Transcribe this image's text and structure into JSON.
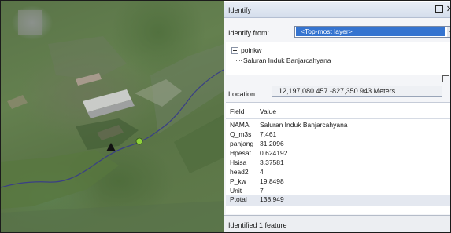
{
  "window": {
    "title": "Identify"
  },
  "identify_from": {
    "label": "Identify from:",
    "selected": "<Top-most layer>"
  },
  "results_tree": {
    "layer": "poinkw",
    "feature": "Saluran Induk Banjarcahyana"
  },
  "location": {
    "label": "Location:",
    "value": "12,197,080.457 -827,350.943 Meters"
  },
  "attributes": {
    "field_header": "Field",
    "value_header": "Value",
    "rows": [
      {
        "field": "NAMA",
        "value": "Saluran Induk Banjarcahyana"
      },
      {
        "field": "Q_m3s",
        "value": "7.461"
      },
      {
        "field": "panjang",
        "value": "31.2096"
      },
      {
        "field": "Hpesat",
        "value": "0.624192"
      },
      {
        "field": "Hsisa",
        "value": "3.37581"
      },
      {
        "field": "head2",
        "value": "4"
      },
      {
        "field": "P_kw",
        "value": "19.8498"
      },
      {
        "field": "Unit",
        "value": "7"
      },
      {
        "field": "Ptotal",
        "value": "138.949"
      }
    ]
  },
  "status": {
    "text": "Identified 1 feature"
  },
  "map": {
    "canal_color": "#3a3f86",
    "point_color": "#8fd13a",
    "marker_color": "#111111",
    "icons": [
      "triangle-marker-icon",
      "green-point-icon"
    ]
  },
  "colors": {
    "selection": "#3574d0",
    "panel_bg": "#f4f5f8"
  }
}
